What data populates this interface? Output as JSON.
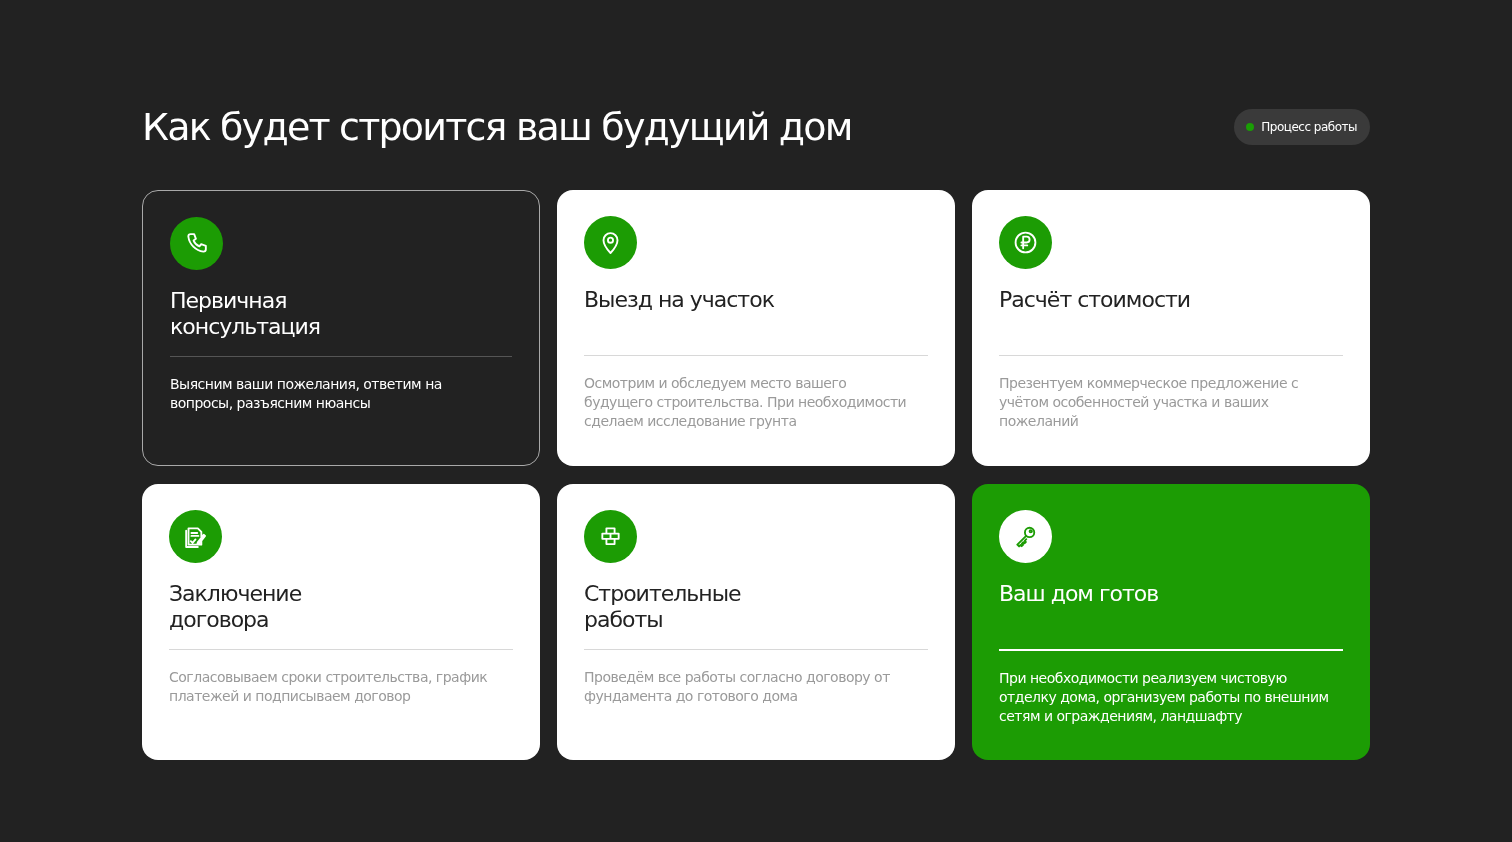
{
  "heading": "Как будет строится ваш будущий дом",
  "badge": {
    "label": "Процесс работы"
  },
  "cards": [
    {
      "kind": "dark",
      "title": "Первичная консультация",
      "text": "Выясним ваши пожелания, ответим на вопросы, разъясним нюансы"
    },
    {
      "kind": "light",
      "title": "Выезд на участок",
      "text": "Осмотрим и обследуем место вашего будущего строительства. При необходимости сделаем исследование грунта"
    },
    {
      "kind": "light",
      "title": "Расчёт стоимости",
      "text": "Презентуем коммерческое предложение с учётом особенностей участка и ваших пожеланий"
    },
    {
      "kind": "light",
      "title": "Заключение договора",
      "text": "Согласовываем сроки строительства, график платежей и подписываем договор"
    },
    {
      "kind": "light",
      "title": "Строительные работы",
      "text": "Проведём все работы согласно договору от фундамента до готового дома"
    },
    {
      "kind": "green",
      "title": "Ваш дом готов",
      "text": "При необходимости реализуем чистовую отделку дома, организуем работы по внешним сетям и ограждениям, ландшафту"
    }
  ]
}
